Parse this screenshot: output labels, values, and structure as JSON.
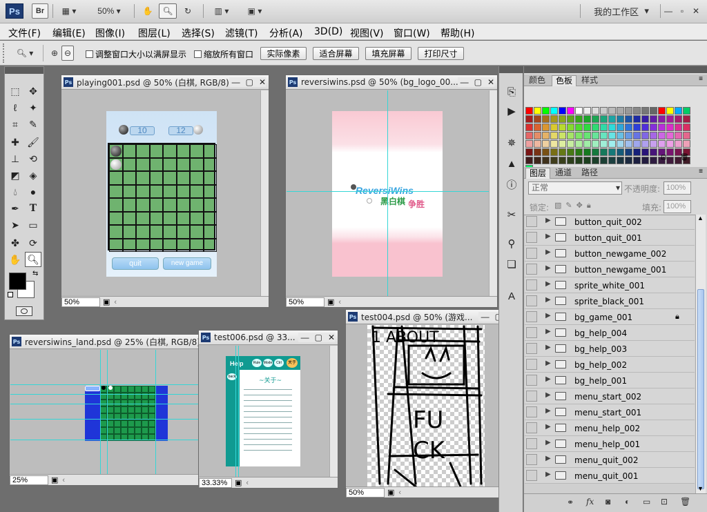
{
  "app": {
    "logo": "Ps",
    "bridge": "Br",
    "zoom_value": "50%",
    "workspace": "我的工作区",
    "window_controls": [
      "—",
      "▫",
      "✕"
    ]
  },
  "menu": [
    "文件(F)",
    "编辑(E)",
    "图像(I)",
    "图层(L)",
    "选择(S)",
    "滤镜(T)",
    "分析(A)",
    "3D(D)",
    "视图(V)",
    "窗口(W)",
    "帮助(H)"
  ],
  "options": {
    "resize_windows": "调整窗口大小以满屏显示",
    "zoom_all": "缩放所有窗口",
    "actual_pixels": "实际像素",
    "fit_screen": "适合屏幕",
    "fill_screen": "填充屏幕",
    "print_size": "打印尺寸"
  },
  "documents": {
    "d1": {
      "title": "playing001.psd @ 50% (白棋, RGB/8)",
      "zoom": "50%",
      "score_left": "10",
      "score_right": "12",
      "btn_quit": "quit",
      "btn_new": "new game"
    },
    "d2": {
      "title": "reversiwins.psd @ 50% (bg_logo_00...",
      "zoom": "50%",
      "logo_en": "ReversiWins",
      "logo_cn1": "黑白棋",
      "logo_cn2": "争胜"
    },
    "d3": {
      "title": "reversiwins_land.psd @ 25% (白棋, RGB/8)",
      "zoom": "25%"
    },
    "d4": {
      "title": "test006.psd @ 33...",
      "zoom": "33.33%",
      "tab_help": "Help",
      "tab_rule": "Rule",
      "tab_mode": "Mode",
      "tab_ctrl": "Ctrl",
      "tab_about": "关于",
      "back": "back",
      "heading": "~关于~"
    },
    "d5": {
      "title": "test004.psd @ 50% (游戏...",
      "zoom": "50%",
      "sketch_top": "1 ABOUT",
      "sketch_mid1": "FU",
      "sketch_mid2": "CK"
    }
  },
  "panels": {
    "swatch_tabs": [
      "颜色",
      "色板",
      "样式"
    ],
    "layer_tabs": [
      "图层",
      "通道",
      "路径"
    ],
    "blend_mode": "正常",
    "opacity_label": "不透明度:",
    "opacity_value": "100%",
    "lock_label": "锁定:",
    "fill_label": "填充:",
    "fill_value": "100%",
    "layers": [
      {
        "name": "button_quit_002",
        "locked": false
      },
      {
        "name": "button_quit_001",
        "locked": false
      },
      {
        "name": "button_newgame_002",
        "locked": false
      },
      {
        "name": "button_newgame_001",
        "locked": false
      },
      {
        "name": "sprite_white_001",
        "locked": false
      },
      {
        "name": "sprite_black_001",
        "locked": false
      },
      {
        "name": "bg_game_001",
        "locked": true
      },
      {
        "name": "bg_help_004",
        "locked": false
      },
      {
        "name": "bg_help_003",
        "locked": false
      },
      {
        "name": "bg_help_002",
        "locked": false
      },
      {
        "name": "bg_help_001",
        "locked": false
      },
      {
        "name": "menu_start_002",
        "locked": false
      },
      {
        "name": "menu_start_001",
        "locked": false
      },
      {
        "name": "menu_help_002",
        "locked": false
      },
      {
        "name": "menu_help_001",
        "locked": false
      },
      {
        "name": "menu_quit_002",
        "locked": false
      },
      {
        "name": "menu_quit_001",
        "locked": false
      }
    ]
  },
  "colors": {
    "ps_blue": "#1d3b73",
    "board_green": "#6fb36f",
    "guide_cyan": "#34d6d6",
    "land_blue": "#1f35d8",
    "land_green": "#1d9a4c",
    "teal": "#109a91"
  }
}
